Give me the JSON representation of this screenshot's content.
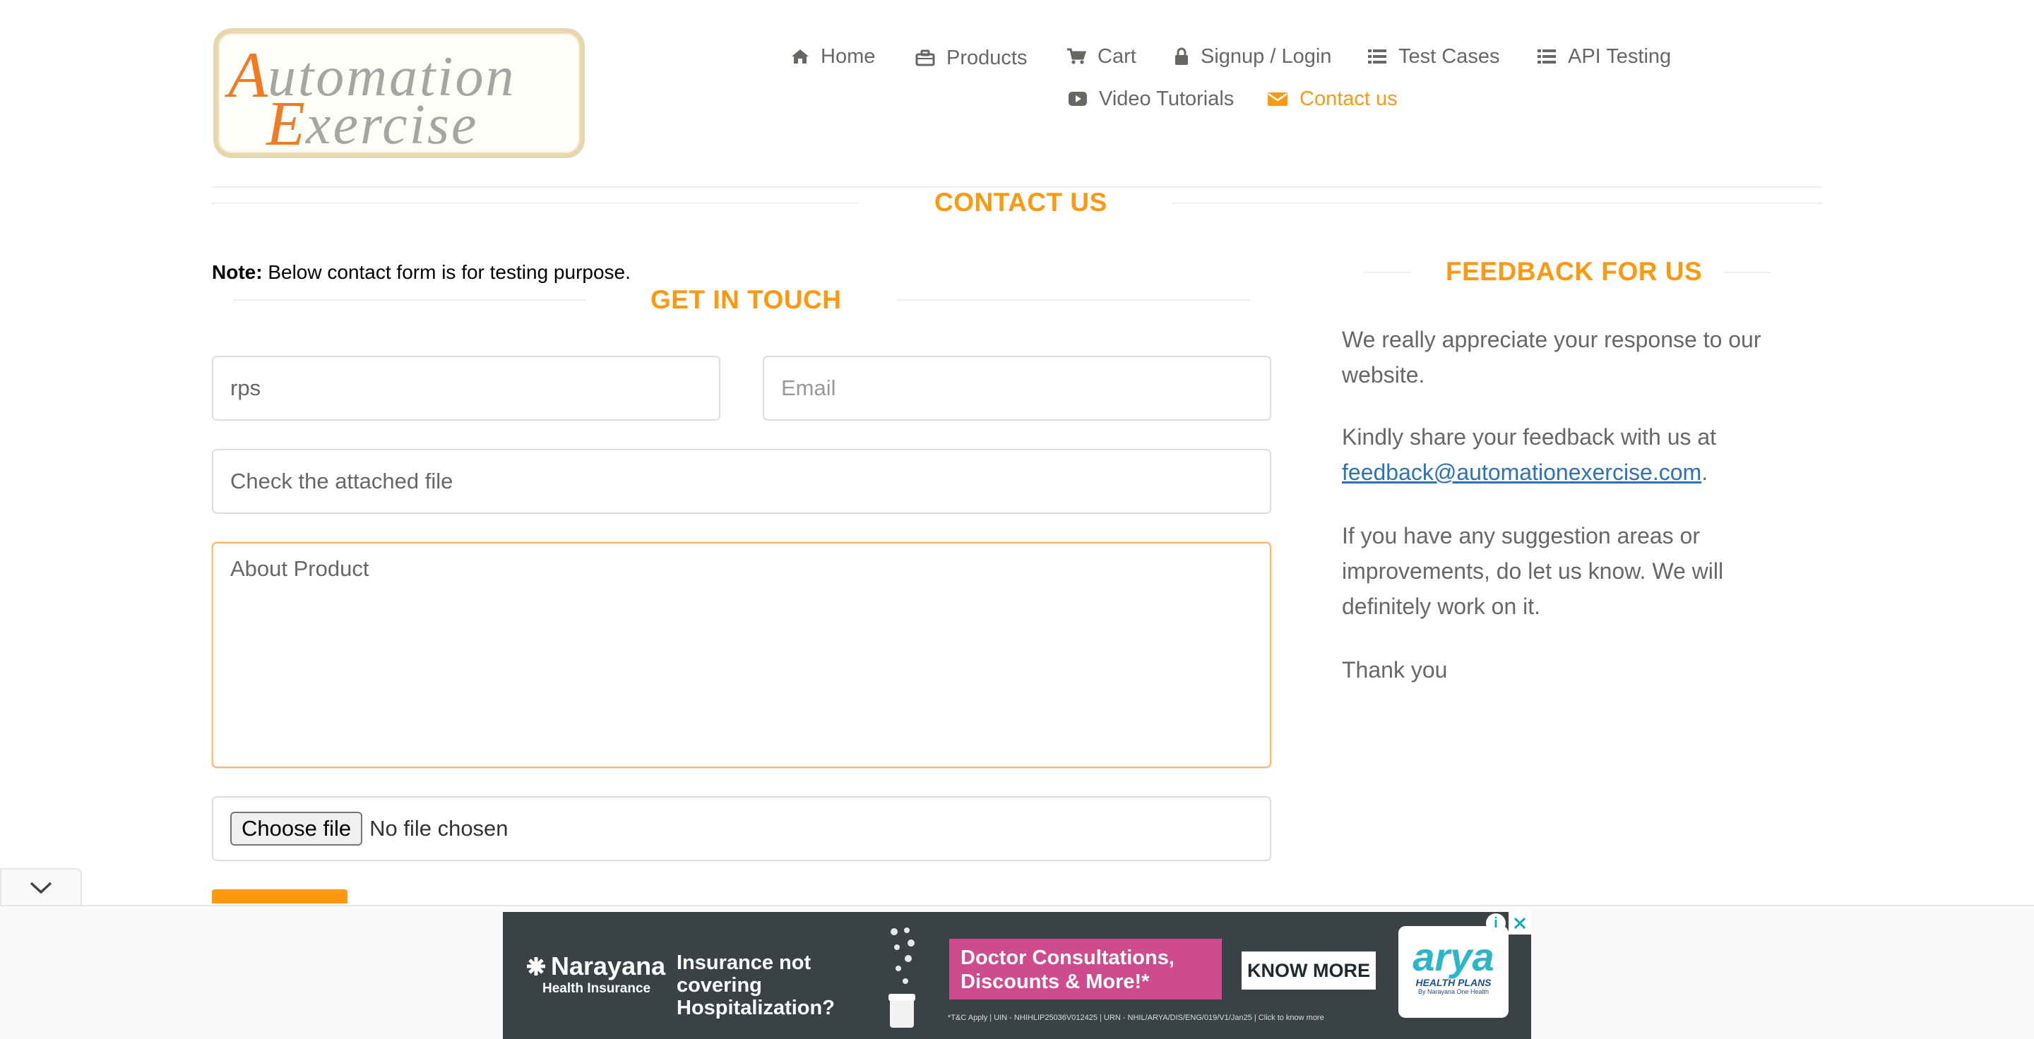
{
  "logo": {
    "line1": "Automation",
    "line2": "Exercise"
  },
  "nav": {
    "home": "Home",
    "products": "Products",
    "cart": "Cart",
    "signup": "Signup / Login",
    "test_cases": "Test Cases",
    "api_testing": "API Testing",
    "video_tutorials": "Video Tutorials",
    "contact_us": "Contact us",
    "active": "contact_us",
    "accent_color": "#fe980f"
  },
  "page": {
    "title": "CONTACT US",
    "note_label": "Note:",
    "note_text": " Below contact form is for testing purpose."
  },
  "form": {
    "title": "GET IN TOUCH",
    "name_value": "rps",
    "email_placeholder": "Email",
    "subject_value": "Check the attached file",
    "message_value": "About Product",
    "file_button": "Choose file",
    "file_status": "No file chosen"
  },
  "feedback": {
    "title": "FEEDBACK FOR US",
    "p1": "We really appreciate your response to our website.",
    "p2_prefix": "Kindly share your feedback with us at ",
    "email": "feedback@automationexercise.com",
    "p2_suffix": ".",
    "p3": "If you have any suggestion areas or improvements, do let us know. We will definitely work on it.",
    "p4": "Thank you"
  },
  "ad": {
    "brand": "Narayana",
    "brand_sub": "Health Insurance",
    "question": "Insurance not covering Hospitalization?",
    "offer": "Doctor Consultations, Discounts & More!*",
    "cta": "KNOW MORE",
    "partner": "arya",
    "partner_sub": "HEALTH PLANS",
    "partner_tag": "By Narayana One Health",
    "fine_print": "*T&C Apply | UIN - NHIHLIP25036V012425 | URN - NHIL/ARYA/DIS/ENG/019/V1/Jan25 | Click to know more"
  }
}
